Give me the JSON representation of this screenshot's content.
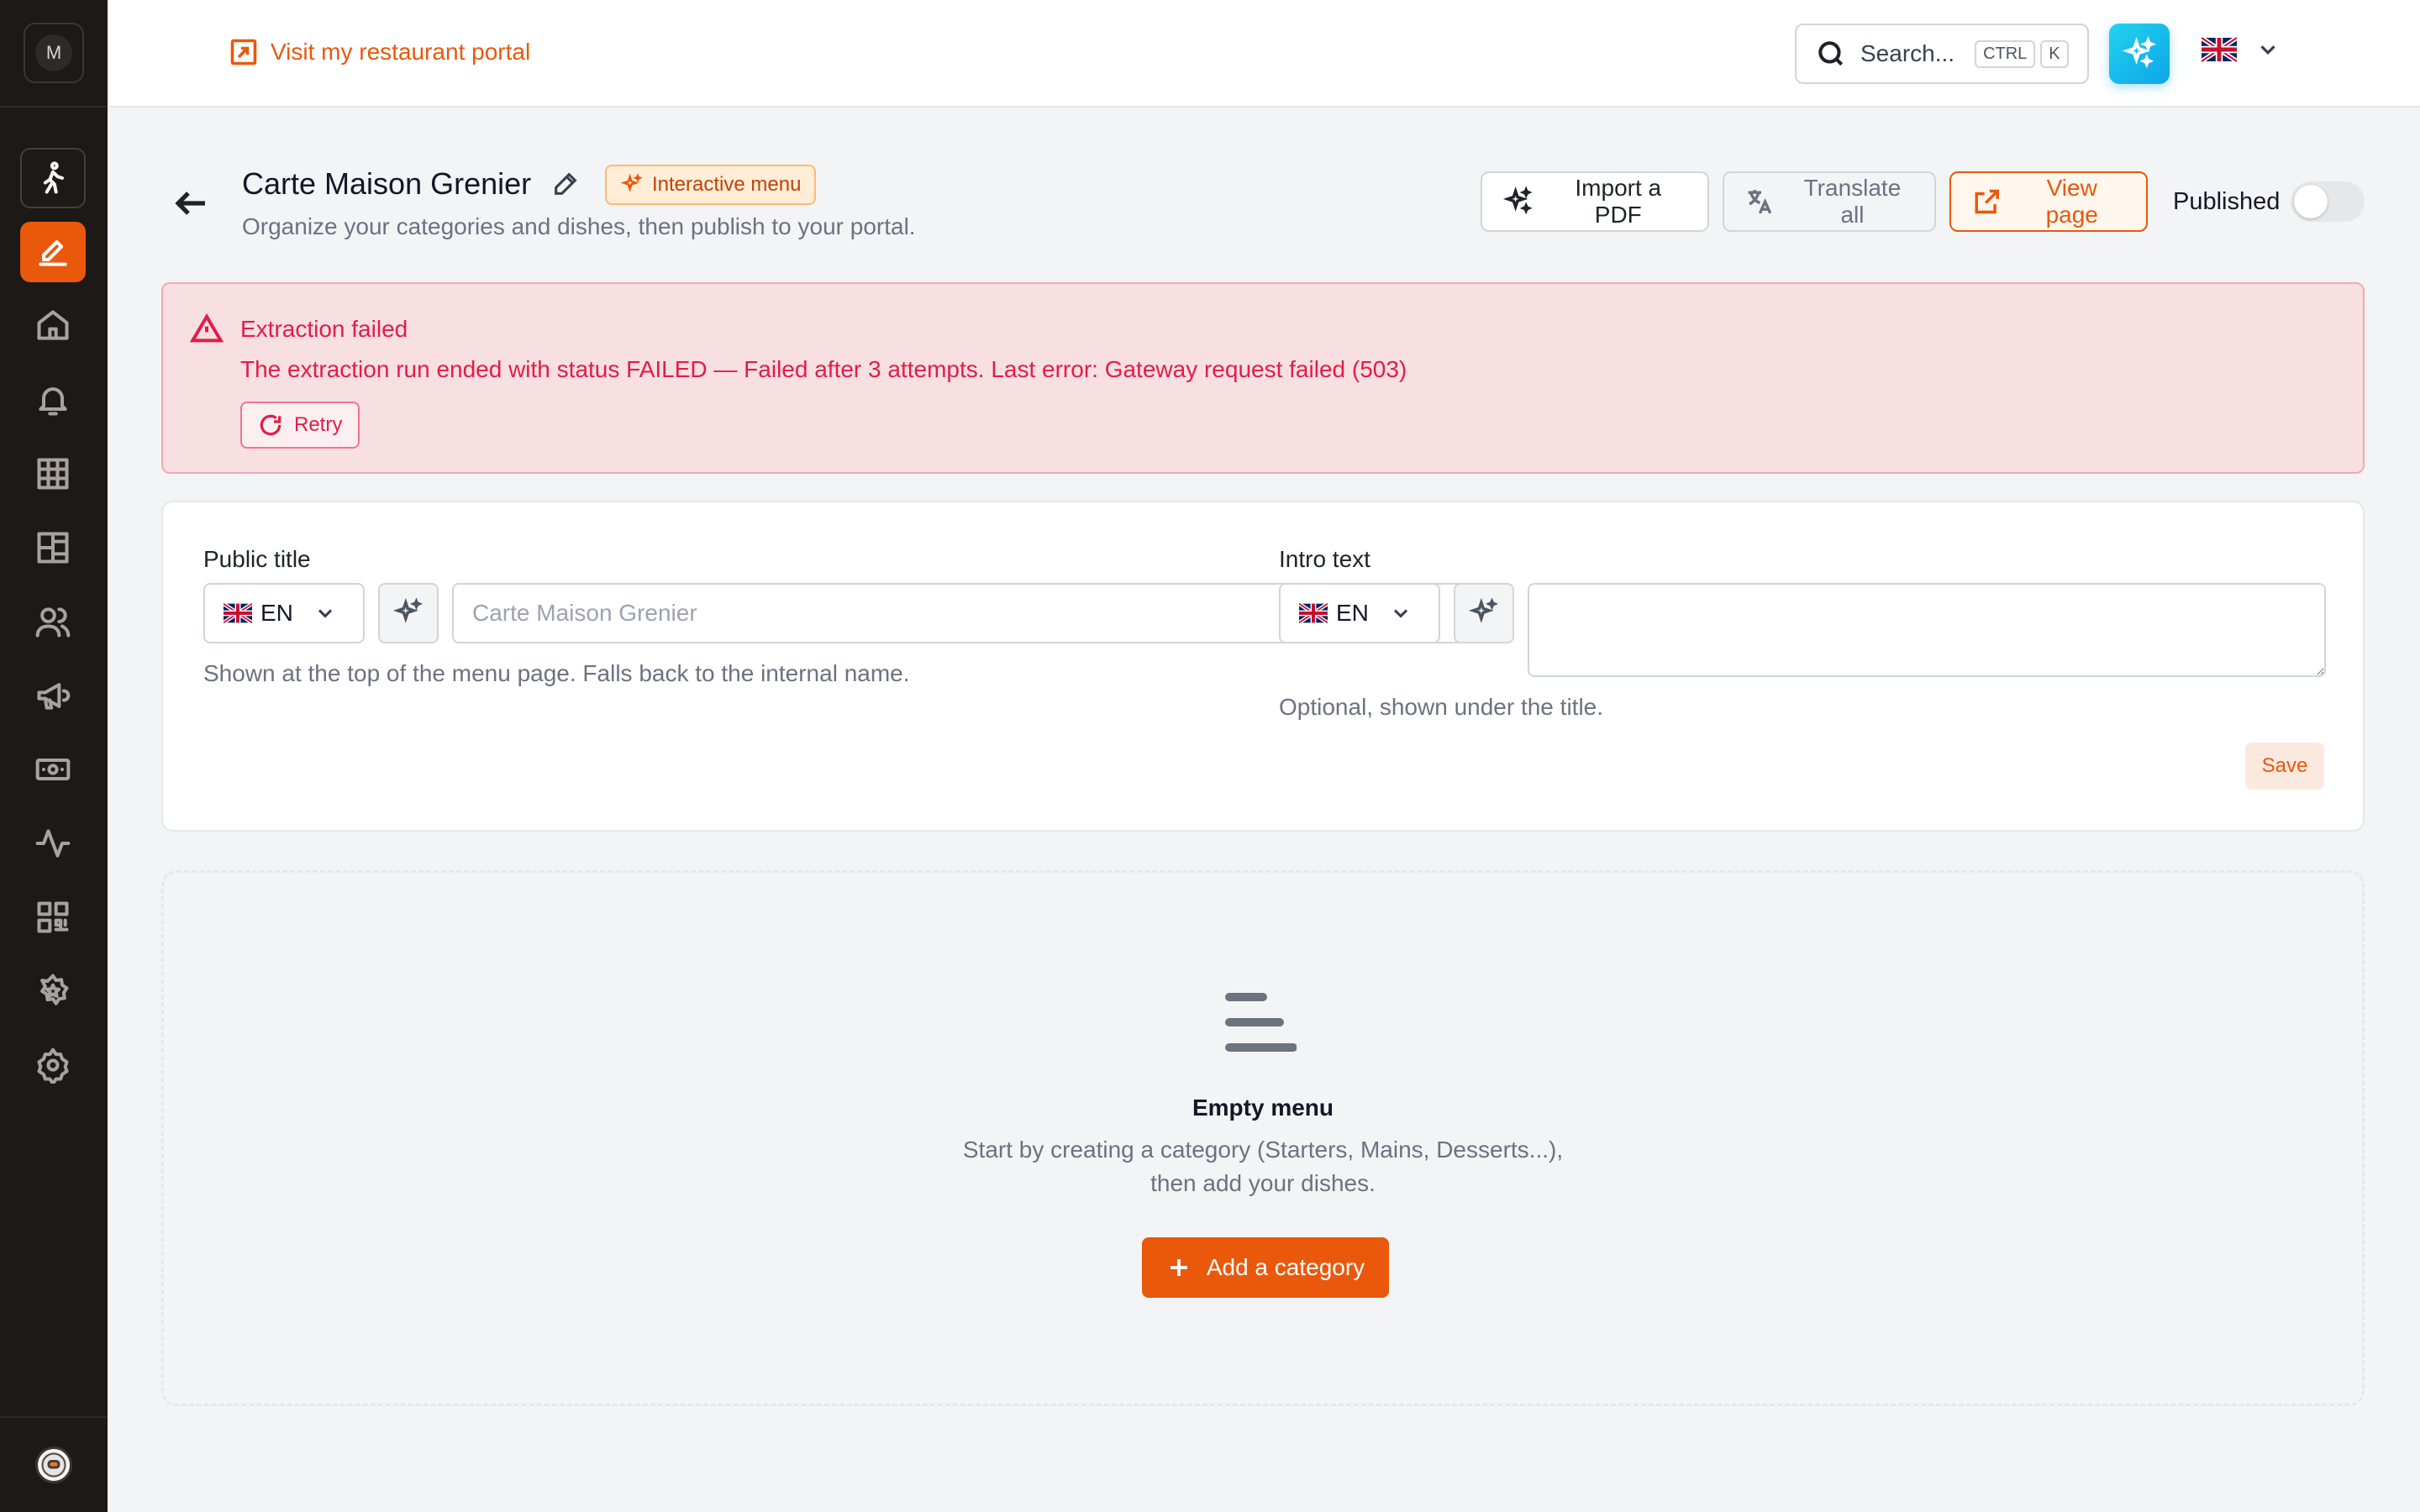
{
  "sidebar": {
    "logo_letter": "M",
    "items": [
      {
        "name": "walking-person-icon"
      },
      {
        "name": "edit-icon"
      },
      {
        "name": "home-icon"
      },
      {
        "name": "bell-icon"
      },
      {
        "name": "grid-icon"
      },
      {
        "name": "layout-icon"
      },
      {
        "name": "users-icon"
      },
      {
        "name": "megaphone-icon"
      },
      {
        "name": "banknote-icon"
      },
      {
        "name": "activity-icon"
      },
      {
        "name": "qr-code-icon"
      },
      {
        "name": "badge-star-icon"
      },
      {
        "name": "settings-icon"
      }
    ],
    "active_item": "edit-icon"
  },
  "topbar": {
    "portal_link": "Visit my restaurant portal",
    "search_label": "Search...",
    "shortcut_keys": [
      "CTRL",
      "K"
    ],
    "language_flag": "uk-flag-icon"
  },
  "header": {
    "title": "Carte Maison Grenier",
    "badge": "Interactive menu",
    "subtitle": "Organize your categories and dishes, then publish to your portal.",
    "import_pdf": "Import a PDF",
    "translate_all": "Translate all",
    "view_page": "View page",
    "published_label": "Published",
    "published": false
  },
  "error": {
    "title": "Extraction failed",
    "message": "The extraction run ended with status FAILED — Failed after 3 attempts. Last error: Gateway request failed (503)",
    "retry": "Retry"
  },
  "form": {
    "public_title": {
      "label": "Public title",
      "lang": "EN",
      "placeholder": "Carte Maison Grenier",
      "value": "",
      "help": "Shown at the top of the menu page. Falls back to the internal name."
    },
    "intro_text": {
      "label": "Intro text",
      "lang": "EN",
      "value": "",
      "help": "Optional, shown under the title."
    },
    "save": "Save"
  },
  "empty_state": {
    "title": "Empty menu",
    "line1": "Start by creating a category (Starters, Mains, Desserts...),",
    "line2": "then add your dishes.",
    "add_button": "Add a category"
  },
  "colors": {
    "accent": "#ea580c",
    "sidebar_bg": "#1c1917",
    "error_text": "#e11d48",
    "error_bg": "#f8dfe2",
    "ai_gradient": "#22d3ee"
  }
}
